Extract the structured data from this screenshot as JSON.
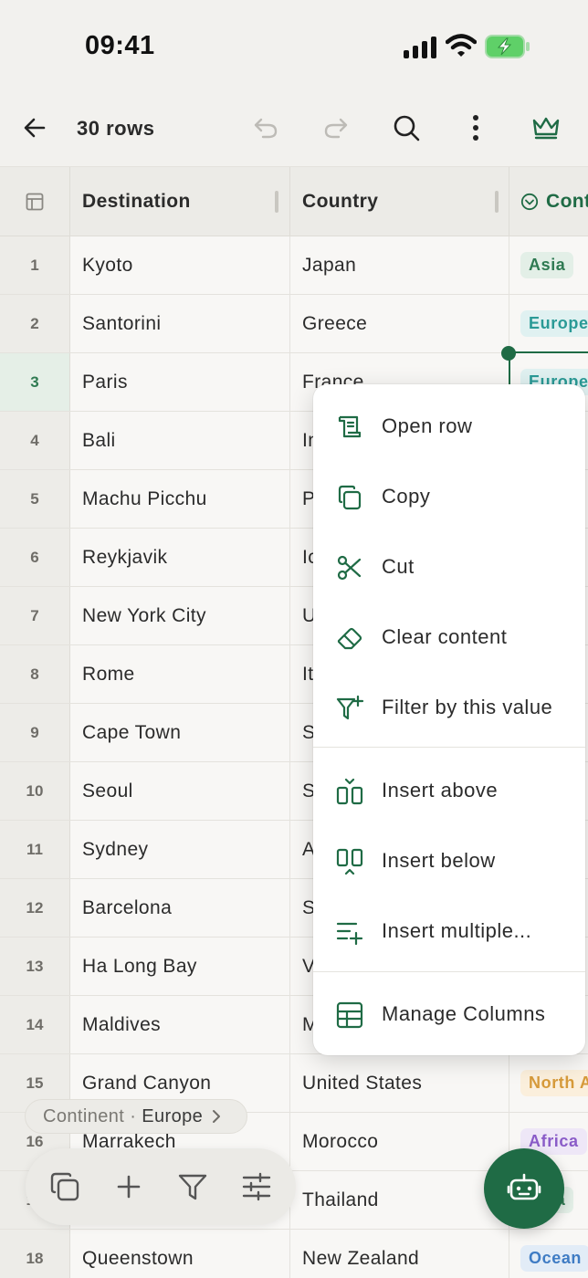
{
  "status_bar": {
    "time": "09:41"
  },
  "toolbar": {
    "title": "30 rows"
  },
  "table": {
    "headers": {
      "col1": "Destination",
      "col2": "Country",
      "col3": "Cont"
    },
    "rows": [
      {
        "num": "1",
        "destination": "Kyoto",
        "country": "Japan",
        "continent": "Asia"
      },
      {
        "num": "2",
        "destination": "Santorini",
        "country": "Greece",
        "continent": "Europe"
      },
      {
        "num": "3",
        "destination": "Paris",
        "country": "France",
        "continent": "Europe"
      },
      {
        "num": "4",
        "destination": "Bali",
        "country": "Indonesia",
        "continent": ""
      },
      {
        "num": "5",
        "destination": "Machu Picchu",
        "country": "Peru",
        "continent": ""
      },
      {
        "num": "6",
        "destination": "Reykjavik",
        "country": "Iceland",
        "continent": ""
      },
      {
        "num": "7",
        "destination": "New York City",
        "country": "United States",
        "continent": ""
      },
      {
        "num": "8",
        "destination": "Rome",
        "country": "Italy",
        "continent": ""
      },
      {
        "num": "9",
        "destination": "Cape Town",
        "country": "South Africa",
        "continent": ""
      },
      {
        "num": "10",
        "destination": "Seoul",
        "country": "South Korea",
        "continent": ""
      },
      {
        "num": "11",
        "destination": "Sydney",
        "country": "Australia",
        "continent": ""
      },
      {
        "num": "12",
        "destination": "Barcelona",
        "country": "Spain",
        "continent": ""
      },
      {
        "num": "13",
        "destination": "Ha Long Bay",
        "country": "Vietnam",
        "continent": ""
      },
      {
        "num": "14",
        "destination": "Maldives",
        "country": "Maldives",
        "continent": ""
      },
      {
        "num": "15",
        "destination": "Grand Canyon",
        "country": "United States",
        "continent": "North A"
      },
      {
        "num": "16",
        "destination": "Marrakech",
        "country": "Morocco",
        "continent": "Africa"
      },
      {
        "num": "17",
        "destination": "",
        "country": "Thailand",
        "continent": "Asia"
      },
      {
        "num": "18",
        "destination": "Queenstown",
        "country": "New Zealand",
        "continent": "Ocean"
      }
    ]
  },
  "tag_colors": {
    "Asia": {
      "bg": "#e3efe7",
      "fg": "#2f7a52"
    },
    "Europe": {
      "bg": "#e0f1f1",
      "fg": "#2a9a96"
    },
    "North A": {
      "bg": "#fbefdc",
      "fg": "#d69a3a"
    },
    "Africa": {
      "bg": "#eee7f7",
      "fg": "#8a5cc8"
    },
    "Ocean": {
      "bg": "#e2ecf7",
      "fg": "#3f7cc4"
    }
  },
  "context_menu": {
    "items": [
      {
        "label": "Open row",
        "icon": "open-row-icon"
      },
      {
        "label": "Copy",
        "icon": "copy-icon"
      },
      {
        "label": "Cut",
        "icon": "scissors-icon"
      },
      {
        "label": "Clear content",
        "icon": "eraser-icon"
      },
      {
        "label": "Filter by this value",
        "icon": "filter-plus-icon"
      },
      {
        "label": "Insert above",
        "icon": "insert-above-icon"
      },
      {
        "label": "Insert below",
        "icon": "insert-below-icon"
      },
      {
        "label": "Insert multiple...",
        "icon": "insert-multiple-icon"
      },
      {
        "label": "Manage Columns",
        "icon": "table-icon"
      }
    ]
  },
  "filter_chip": {
    "field": "Continent",
    "separator": "·",
    "value": "Europe"
  },
  "accent_color": "#1f6b45"
}
